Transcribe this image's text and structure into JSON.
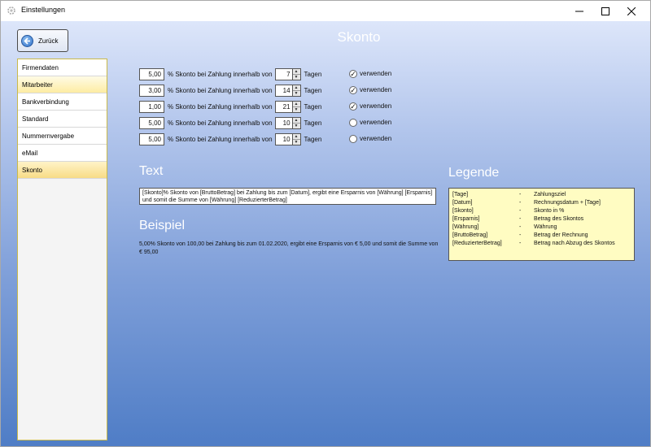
{
  "window": {
    "title": "Einstellungen"
  },
  "header": {
    "back_label": "Zurück",
    "page_title": "Skonto"
  },
  "sidebar": {
    "items": [
      {
        "label": "Firmendaten",
        "style": "plain"
      },
      {
        "label": "Mitarbeiter",
        "style": "yellow"
      },
      {
        "label": "Bankverbindung",
        "style": "plain"
      },
      {
        "label": "Standard",
        "style": "plain"
      },
      {
        "label": "Nummernvergabe",
        "style": "plain"
      },
      {
        "label": "eMail",
        "style": "plain"
      },
      {
        "label": "Skonto",
        "style": "active"
      }
    ]
  },
  "skonto_rows": [
    {
      "percent": "5,00",
      "text": "% Skonto bei Zahlung innerhalb von",
      "days": "7",
      "days_label": "Tagen",
      "checked": true,
      "use_label": "verwenden"
    },
    {
      "percent": "3,00",
      "text": "% Skonto bei Zahlung innerhalb von",
      "days": "14",
      "days_label": "Tagen",
      "checked": true,
      "use_label": "verwenden"
    },
    {
      "percent": "1,00",
      "text": "% Skonto bei Zahlung innerhalb von",
      "days": "21",
      "days_label": "Tagen",
      "checked": true,
      "use_label": "verwenden"
    },
    {
      "percent": "5,00",
      "text": "% Skonto bei Zahlung innerhalb von",
      "days": "10",
      "days_label": "Tagen",
      "checked": false,
      "use_label": "verwenden"
    },
    {
      "percent": "5,00",
      "text": "% Skonto bei Zahlung innerhalb von",
      "days": "10",
      "days_label": "Tagen",
      "checked": false,
      "use_label": "verwenden"
    }
  ],
  "text_section": {
    "heading": "Text",
    "value": "[Skonto]% Skonto von [BruttoBetrag] bei Zahlung bis zum [Datum], ergibt eine Ersparnis von [Währung] [Ersparnis] und somit die Summe von [Währung] [ReduzierterBetrag]"
  },
  "beispiel": {
    "heading": "Beispiel",
    "text": "5,00% Skonto von 100,00 bei Zahlung bis zum 01.02.2020, ergibt eine Ersparnis von € 5,00 und somit die Summe von € 95,00"
  },
  "legende": {
    "heading": "Legende",
    "dash": "-",
    "rows": [
      {
        "key": "[Tage]",
        "value": "Zahlungsziel"
      },
      {
        "key": "[Datum]",
        "value": "Rechnungsdatum + [Tage]"
      },
      {
        "key": "[Skonto]",
        "value": "Skonto in %"
      },
      {
        "key": "[Ersparnis]",
        "value": "Betrag des Skontos"
      },
      {
        "key": "[Währung]",
        "value": "Währung"
      },
      {
        "key": "[BruttoBetrag]",
        "value": "Betrag der Rechnung"
      },
      {
        "key": "[ReduzierterBetrag]",
        "value": "Betrag nach Abzug des Skontos"
      }
    ]
  },
  "icons": {
    "app": "gear-icon",
    "back": "arrow-left-icon",
    "minimize": "minimize-icon",
    "maximize": "maximize-icon",
    "close": "close-icon",
    "check": "check-icon",
    "spin_up": "spin-up-icon",
    "spin_down": "spin-down-icon"
  },
  "colors": {
    "title_text": "#ffffff",
    "legend_bg": "#fffcc2",
    "sidebar_active": "#f8dc86",
    "back_circle": "#2f6fc7"
  }
}
